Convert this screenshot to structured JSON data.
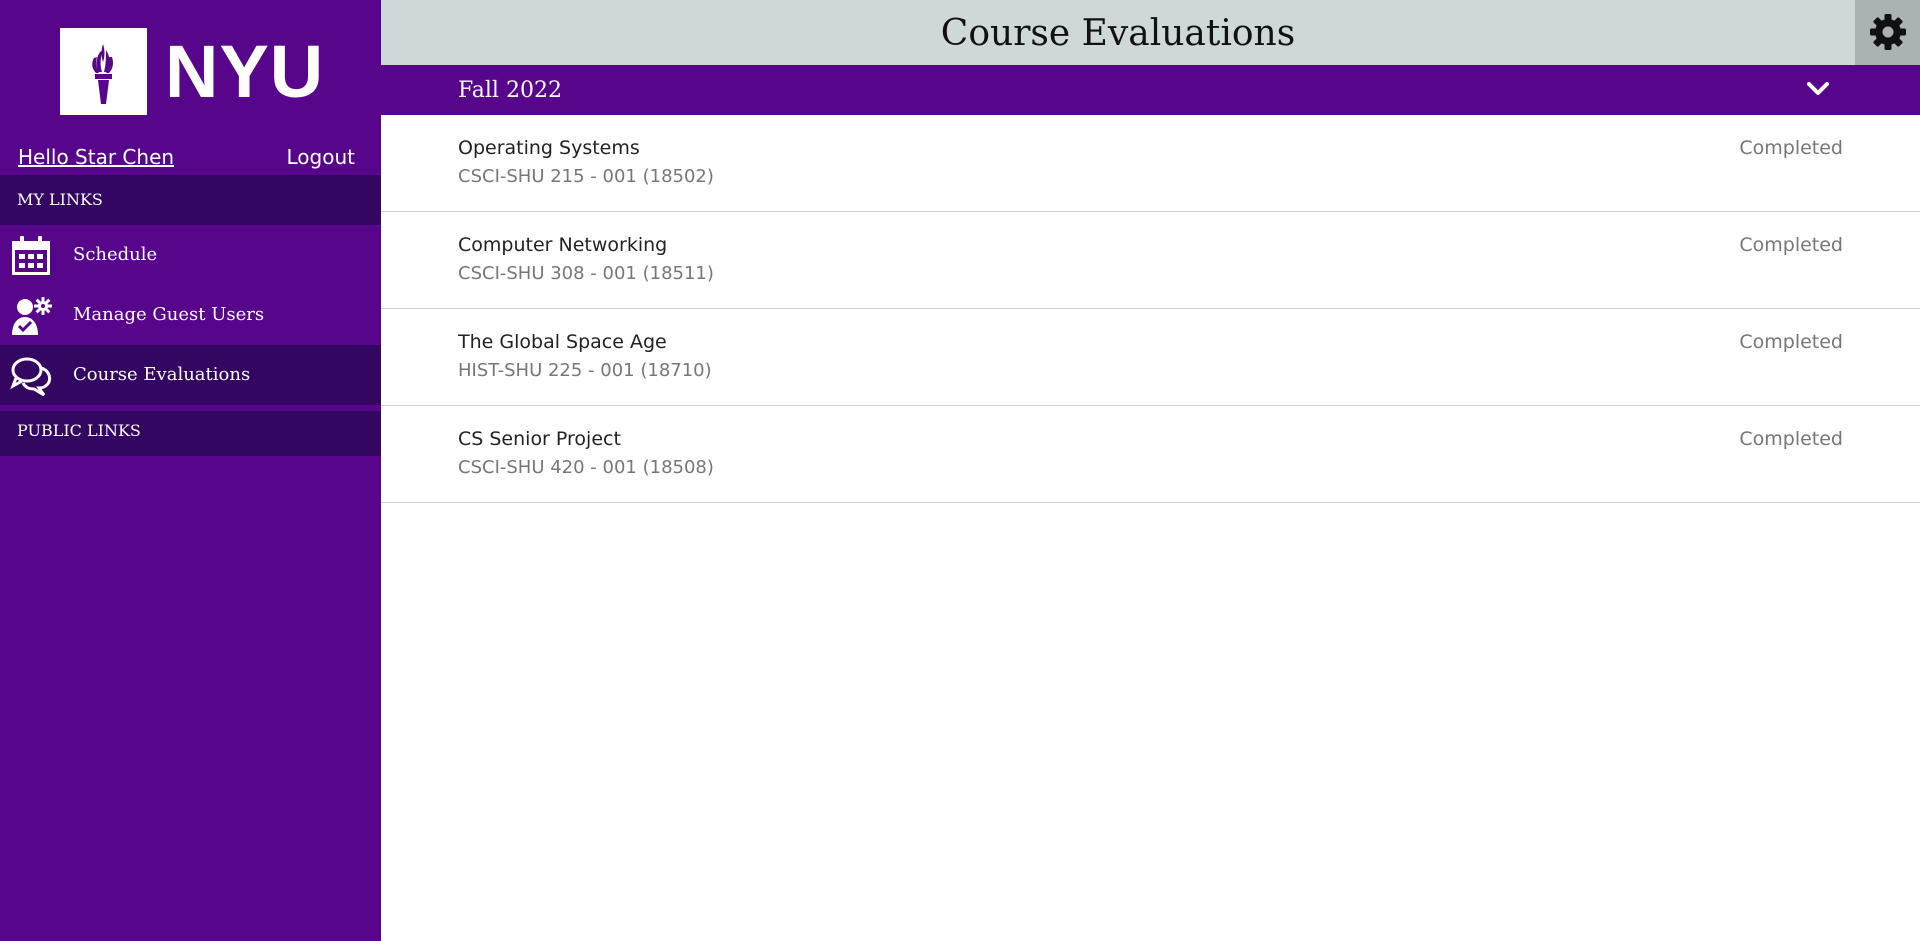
{
  "brand": {
    "logo_text": "NYU",
    "logo_icon": "torch-icon",
    "primary_color": "#57068c",
    "dark_purple": "#330662"
  },
  "sidebar": {
    "greeting": "Hello Star Chen",
    "logout_label": "Logout",
    "my_links_header": "MY LINKS",
    "public_links_header": "PUBLIC LINKS",
    "items": [
      {
        "label": "Schedule",
        "icon": "calendar-icon",
        "active": false
      },
      {
        "label": "Manage Guest Users",
        "icon": "guest-user-settings-icon",
        "active": false
      },
      {
        "label": "Course Evaluations",
        "icon": "chat-bubbles-icon",
        "active": true
      }
    ]
  },
  "header": {
    "title": "Course Evaluations",
    "settings_icon": "gear-icon",
    "background": "#cfd8d8"
  },
  "term": {
    "label": "Fall 2022",
    "toggle_icon": "chevron-down-icon"
  },
  "courses": [
    {
      "name": "Operating Systems",
      "code": "CSCI-SHU 215 - 001 (18502)",
      "status": "Completed"
    },
    {
      "name": "Computer Networking",
      "code": "CSCI-SHU 308 - 001 (18511)",
      "status": "Completed"
    },
    {
      "name": "The Global Space Age",
      "code": "HIST-SHU 225 - 001 (18710)",
      "status": "Completed"
    },
    {
      "name": "CS Senior Project",
      "code": "CSCI-SHU 420 - 001 (18508)",
      "status": "Completed"
    }
  ]
}
